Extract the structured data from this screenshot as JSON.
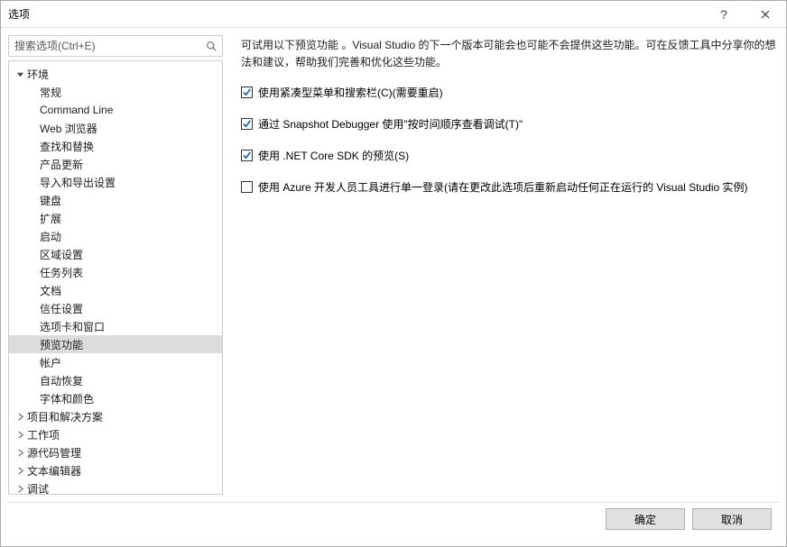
{
  "window": {
    "title": "选项"
  },
  "search": {
    "placeholder": "搜索选项(Ctrl+E)"
  },
  "tree": {
    "top": [
      {
        "label": "环境",
        "expanded": true
      },
      {
        "label": "项目和解决方案",
        "expanded": false
      },
      {
        "label": "工作项",
        "expanded": false
      },
      {
        "label": "源代码管理",
        "expanded": false
      },
      {
        "label": "文本编辑器",
        "expanded": false
      },
      {
        "label": "调试",
        "expanded": false
      }
    ],
    "envChildren": [
      "常规",
      "Command Line",
      "Web 浏览器",
      "查找和替换",
      "产品更新",
      "导入和导出设置",
      "键盘",
      "扩展",
      "启动",
      "区域设置",
      "任务列表",
      "文档",
      "信任设置",
      "选项卡和窗口",
      "预览功能",
      "帐户",
      "自动恢复",
      "字体和颜色"
    ],
    "selected": "预览功能"
  },
  "content": {
    "description": "可试用以下预览功能 。Visual Studio 的下一个版本可能会也可能不会提供这些功能。可在反馈工具中分享你的想法和建议，帮助我们完善和优化这些功能。",
    "checks": [
      {
        "label": "使用紧凑型菜单和搜索栏(C)(需要重启)",
        "checked": true
      },
      {
        "label": "通过 Snapshot Debugger 使用\"按时间顺序查看调试(T)\"",
        "checked": true
      },
      {
        "label": "使用 .NET Core SDK 的预览(S)",
        "checked": true
      },
      {
        "label": "使用 Azure 开发人员工具进行单一登录(请在更改此选项后重新启动任何正在运行的 Visual Studio 实例)",
        "checked": false
      }
    ]
  },
  "buttons": {
    "ok": "确定",
    "cancel": "取消"
  },
  "colors": {
    "checkBlue": "#0066cc"
  }
}
